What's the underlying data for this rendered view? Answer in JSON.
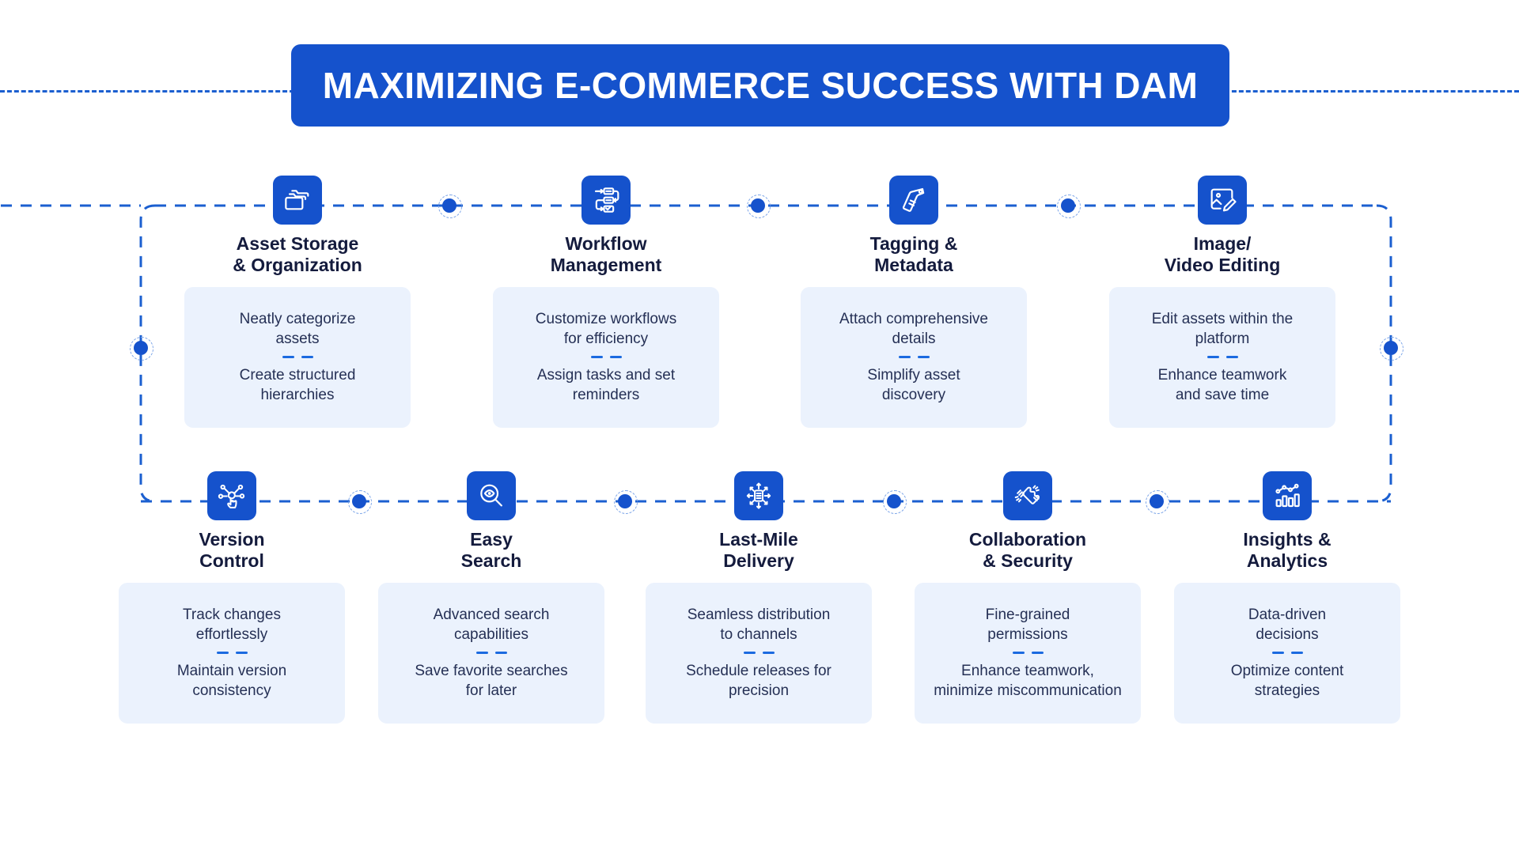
{
  "header": {
    "title": "MAXIMIZING E-COMMERCE SUCCESS WITH DAM",
    "banner_color": "#1552cc",
    "text_color": "#ffffff"
  },
  "theme": {
    "accent": "#1552cc",
    "line": "#1b5fd0",
    "card_bg": "#ebf2fd",
    "title_text": "#141b3d",
    "body_text": "#253055",
    "page_bg": "#ffffff"
  },
  "rows": [
    {
      "name": "row-1",
      "items": [
        {
          "icon": "folder-stack-icon",
          "title": "Asset Storage\n& Organization",
          "desc_top": "Neatly categorize\nassets",
          "desc_bottom": "Create structured\nhierarchies"
        },
        {
          "icon": "workflow-flowchart-icon",
          "title": "Workflow\nManagement",
          "desc_top": "Customize workflows\nfor efficiency",
          "desc_bottom": "Assign tasks and set\nreminders"
        },
        {
          "icon": "price-tag-icon",
          "title": "Tagging &\nMetadata",
          "desc_top": "Attach comprehensive\ndetails",
          "desc_bottom": "Simplify asset\ndiscovery"
        },
        {
          "icon": "image-pencil-edit-icon",
          "title": "Image/\nVideo Editing",
          "desc_top": "Edit assets within the\nplatform",
          "desc_bottom": "Enhance teamwork\nand save time"
        }
      ]
    },
    {
      "name": "row-2",
      "items": [
        {
          "icon": "network-hand-pointer-icon",
          "title": "Version\nControl",
          "desc_top": "Track changes\neffortlessly",
          "desc_bottom": "Maintain version\nconsistency"
        },
        {
          "icon": "magnifier-eye-icon",
          "title": "Easy\nSearch",
          "desc_top": "Advanced search\ncapabilities",
          "desc_bottom": "Save favorite searches\nfor later"
        },
        {
          "icon": "document-distribute-arrows-icon",
          "title": "Last-Mile\nDelivery",
          "desc_top": "Seamless distribution\nto channels",
          "desc_bottom": "Schedule releases for\nprecision"
        },
        {
          "icon": "puzzle-hands-icon",
          "title": "Collaboration\n& Security",
          "desc_top": "Fine-grained\npermissions",
          "desc_bottom": "Enhance teamwork,\nminimize miscommunication"
        },
        {
          "icon": "bar-chart-line-icon",
          "title": "Insights &\nAnalytics",
          "desc_top": "Data-driven\ndecisions",
          "desc_bottom": "Optimize content\nstrategies"
        }
      ]
    }
  ]
}
